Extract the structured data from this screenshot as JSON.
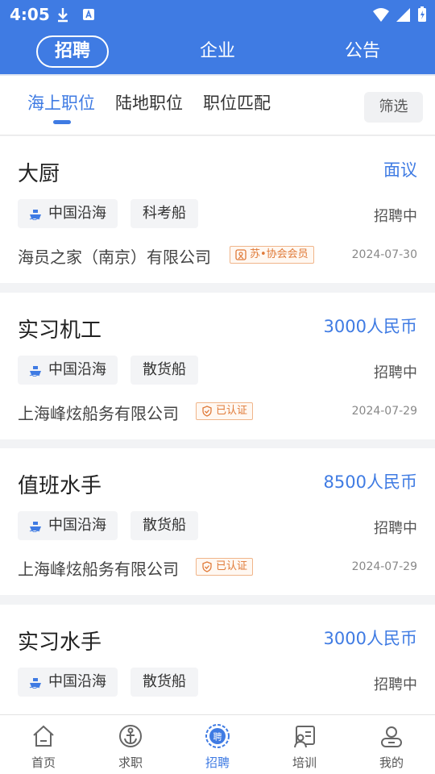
{
  "status_bar": {
    "time": "4:05"
  },
  "top_tabs": [
    {
      "label": "招聘",
      "active": true
    },
    {
      "label": "企业",
      "active": false
    },
    {
      "label": "公告",
      "active": false
    }
  ],
  "sub_tabs": [
    {
      "label": "海上职位",
      "active": true
    },
    {
      "label": "陆地职位",
      "active": false
    },
    {
      "label": "职位匹配",
      "active": false
    }
  ],
  "filter_label": "筛选",
  "jobs": [
    {
      "title": "大厨",
      "salary": "面议",
      "area": "中国沿海",
      "ship_type": "科考船",
      "status": "招聘中",
      "company": "海员之家（南京）有限公司",
      "badge": "苏•协会会员",
      "date": "2024-07-30"
    },
    {
      "title": "实习机工",
      "salary": "3000人民币",
      "area": "中国沿海",
      "ship_type": "散货船",
      "status": "招聘中",
      "company": "上海峰炫船务有限公司",
      "badge": "已认证",
      "date": "2024-07-29"
    },
    {
      "title": "值班水手",
      "salary": "8500人民币",
      "area": "中国沿海",
      "ship_type": "散货船",
      "status": "招聘中",
      "company": "上海峰炫船务有限公司",
      "badge": "已认证",
      "date": "2024-07-29"
    },
    {
      "title": "实习水手",
      "salary": "3000人民币",
      "area": "中国沿海",
      "ship_type": "散货船",
      "status": "招聘中"
    }
  ],
  "bottom_nav": [
    {
      "label": "首页",
      "icon": "home-icon"
    },
    {
      "label": "求职",
      "icon": "anchor-icon"
    },
    {
      "label": "招聘",
      "icon": "recruit-icon",
      "active": true
    },
    {
      "label": "培训",
      "icon": "training-icon"
    },
    {
      "label": "我的",
      "icon": "user-icon"
    }
  ],
  "colors": {
    "primary": "#3f7be3",
    "badge": "#e07a38"
  }
}
